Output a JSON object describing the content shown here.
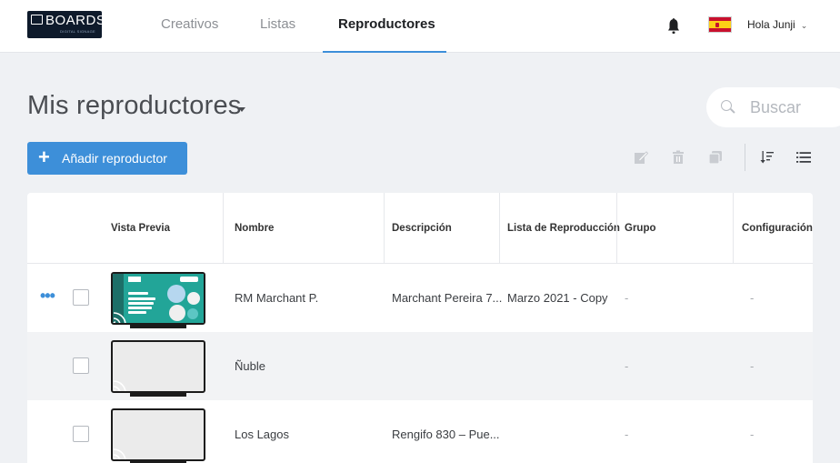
{
  "nav": {
    "logo": "BOARDS",
    "logo_sub": "DIGITAL SIGNAGE",
    "tabs": [
      {
        "label": "Creativos",
        "active": false
      },
      {
        "label": "Listas",
        "active": false
      },
      {
        "label": "Reproductores",
        "active": true
      }
    ],
    "greeting": "Hola Junji",
    "bell_icon": "bell-icon",
    "flag": "spain-flag",
    "accent_color": "#3d8fd9"
  },
  "page": {
    "title": "Mis reproductores",
    "search_placeholder": "Buscar",
    "add_button": "Añadir reproductor"
  },
  "toolbar": {
    "icons": [
      "edit-icon",
      "trash-icon",
      "copy-icon",
      "sort-icon",
      "list-view-icon"
    ]
  },
  "table": {
    "columns": [
      "Vista Previa",
      "Nombre",
      "Descripción",
      "Lista de Reproducción",
      "Grupo",
      "Configuración"
    ],
    "rows": [
      {
        "name": "RM Marchant P.",
        "description": "Marchant Pereira 7...",
        "playlist": "Marzo 2021 - Copy",
        "group": "-",
        "config": "-",
        "has_preview": true,
        "show_menu": true
      },
      {
        "name": "Ñuble",
        "description": "",
        "playlist": "",
        "group": "-",
        "config": "-",
        "has_preview": false,
        "show_menu": false
      },
      {
        "name": "Los Lagos",
        "description": "Rengifo 830 – Pue...",
        "playlist": "",
        "group": "-",
        "config": "-",
        "has_preview": false,
        "show_menu": false
      }
    ]
  },
  "preview_thumb": {
    "brand": "JUNJI",
    "headline": "No olvides",
    "body": "lavar tus manos o desinfectar con alcohol gel antes y después de comer."
  }
}
